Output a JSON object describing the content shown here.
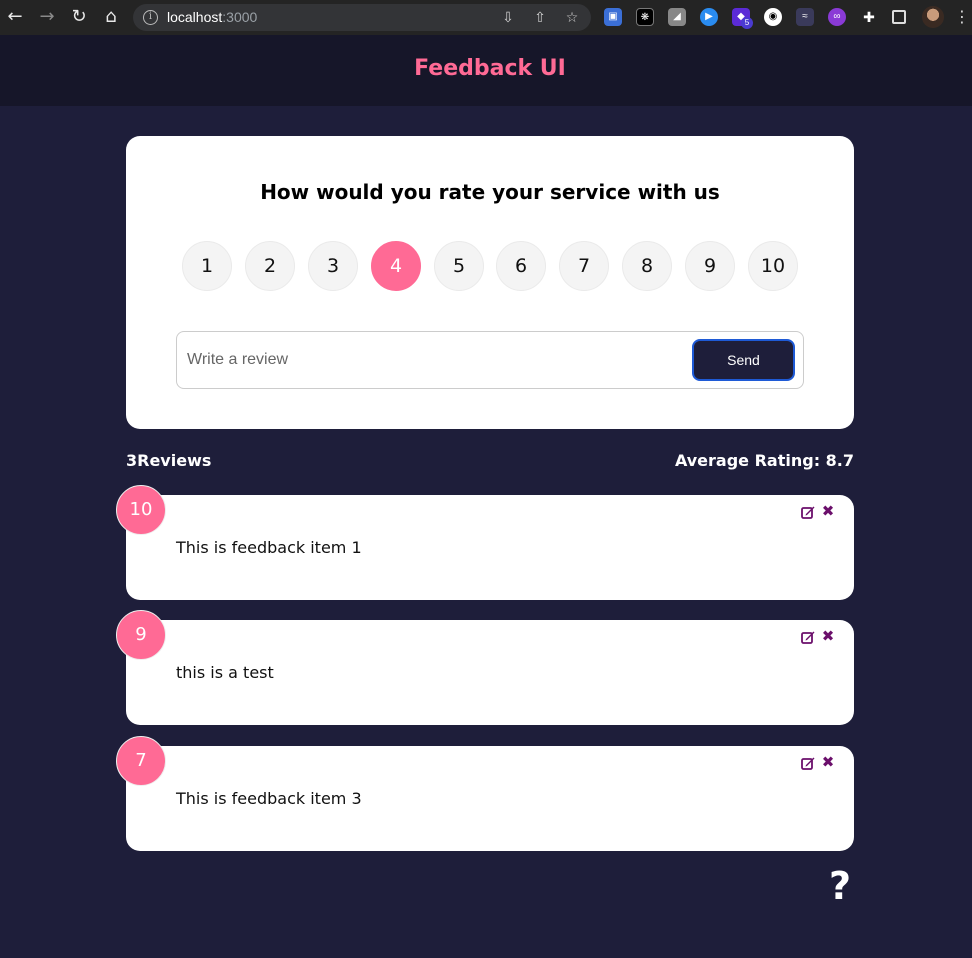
{
  "browser": {
    "url_host": "localhost",
    "url_port": ":3000",
    "extension_badge": "5"
  },
  "app": {
    "title": "Feedback UI"
  },
  "rating_form": {
    "heading": "How would you rate your service with us",
    "options": [
      "1",
      "2",
      "3",
      "4",
      "5",
      "6",
      "7",
      "8",
      "9",
      "10"
    ],
    "selected": "4",
    "review_placeholder": "Write a review",
    "review_value": "",
    "send_label": "Send"
  },
  "stats": {
    "count_label": "3Reviews",
    "average_label": "Average Rating: 8.7"
  },
  "feedback": [
    {
      "rating": "10",
      "text": "This is feedback item 1"
    },
    {
      "rating": "9",
      "text": "this is a test"
    },
    {
      "rating": "7",
      "text": "This is feedback item 3"
    }
  ],
  "about_link": "?",
  "colors": {
    "background": "#1e1e3a",
    "header": "#161629",
    "accent": "#ff6a95",
    "icon_purple": "#6b0f6b"
  }
}
